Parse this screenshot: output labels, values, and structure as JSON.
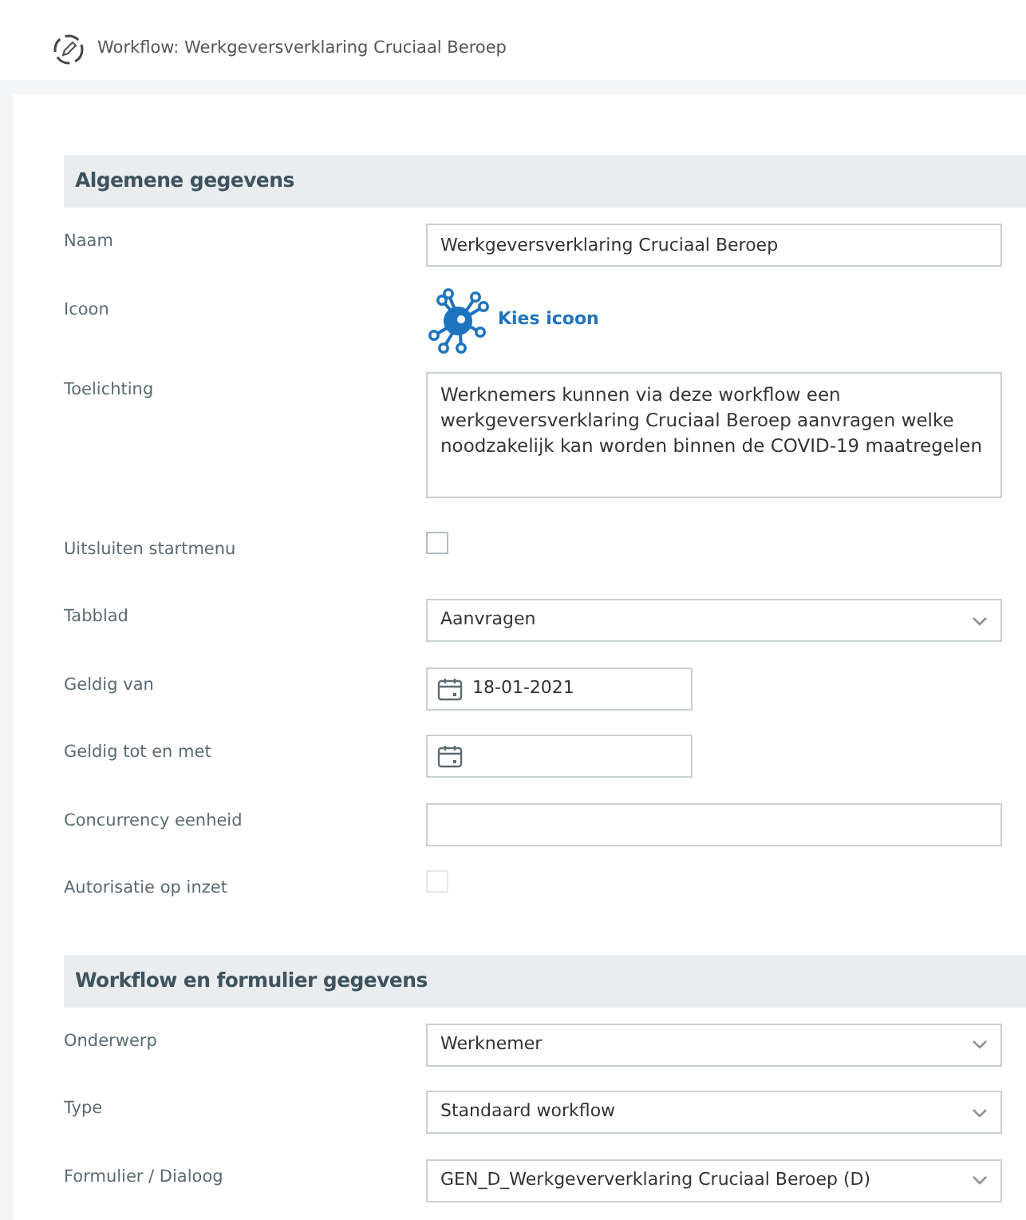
{
  "window": {
    "title": "Workflow: Werkgeversverklaring Cruciaal Beroep"
  },
  "sections": [
    {
      "title": "Algemene gegevens",
      "fields": [
        {
          "kind": "text",
          "label": "Naam",
          "value": "Werkgeversverklaring Cruciaal Beroep"
        },
        {
          "kind": "icon",
          "label": "Icoon",
          "link": "Kies icoon"
        },
        {
          "kind": "textarea",
          "label": "Toelichting",
          "value": "Werknemers kunnen via deze workflow een werkgeversverklaring Cruciaal Beroep aanvragen welke noodzakelijk kan worden binnen de COVID-19 maatregelen"
        },
        {
          "kind": "checkbox",
          "label": "Uitsluiten startmenu",
          "checked": false,
          "disabled": false
        },
        {
          "kind": "select",
          "label": "Tabblad",
          "value": "Aanvragen"
        },
        {
          "kind": "date",
          "label": "Geldig van",
          "value": "18-01-2021"
        },
        {
          "kind": "date",
          "label": "Geldig tot en met"
        },
        {
          "kind": "text",
          "label": "Concurrency eenheid"
        },
        {
          "kind": "checkbox",
          "label": "Autorisatie op inzet",
          "checked": false,
          "disabled": true
        }
      ]
    },
    {
      "title": "Workflow en formulier gegevens",
      "fields": [
        {
          "kind": "select",
          "label": "Onderwerp",
          "value": "Werknemer"
        },
        {
          "kind": "select",
          "label": "Type",
          "value": "Standaard workflow"
        },
        {
          "kind": "select",
          "label": "Formulier / Dialoog",
          "value": "GEN_D_Werkgeververklaring Cruciaal Beroep (D)"
        }
      ]
    }
  ]
}
